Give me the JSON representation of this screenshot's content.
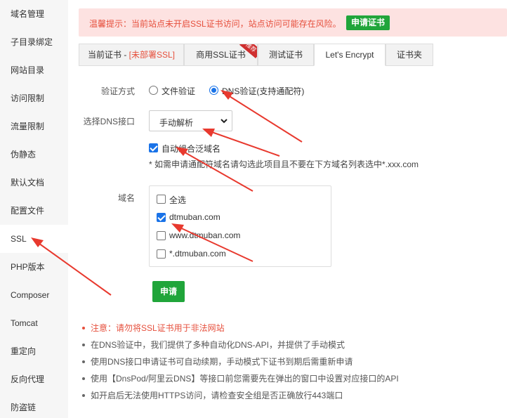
{
  "sidebar": {
    "items": [
      {
        "label": "域名管理"
      },
      {
        "label": "子目录绑定"
      },
      {
        "label": "网站目录"
      },
      {
        "label": "访问限制"
      },
      {
        "label": "流量限制"
      },
      {
        "label": "伪静态"
      },
      {
        "label": "默认文档"
      },
      {
        "label": "配置文件"
      },
      {
        "label": "SSL"
      },
      {
        "label": "PHP版本"
      },
      {
        "label": "Composer"
      },
      {
        "label": "Tomcat"
      },
      {
        "label": "重定向"
      },
      {
        "label": "反向代理"
      },
      {
        "label": "防盗链"
      }
    ],
    "active": "SSL"
  },
  "alert": {
    "text": "温馨提示：当前站点未开启SSL证书访问，站点访问可能存在风险。",
    "button": "申请证书"
  },
  "tabs": {
    "current_prefix": "当前证书 - ",
    "current_status": "[未部署SSL]",
    "commercial": "商用SSL证书",
    "ribbon": "推荐",
    "test": "测试证书",
    "letsencrypt": "Let's Encrypt",
    "folder": "证书夹",
    "active": "Let's Encrypt"
  },
  "form": {
    "verify_label": "验证方式",
    "verify_options": [
      "文件验证",
      "DNS验证(支持通配符)"
    ],
    "verify_selected": "DNS验证(支持通配符)",
    "dns_label": "选择DNS接口",
    "dns_value": "手动解析",
    "auto_combine_label": "自动组合泛域名",
    "auto_combine_checked": true,
    "hint": "* 如需申请通配符域名请勾选此项目且不要在下方域名列表选中*.xxx.com",
    "domain_label": "域名",
    "select_all": "全选",
    "domains": [
      {
        "name": "dtmuban.com",
        "checked": true
      },
      {
        "name": "www.dtmuban.com",
        "checked": false
      },
      {
        "name": "*.dtmuban.com",
        "checked": false
      }
    ],
    "apply_button": "申请"
  },
  "notes": [
    "注意：请勿将SSL证书用于非法网站",
    "在DNS验证中，我们提供了多种自动化DNS-API，并提供了手动模式",
    "使用DNS接口申请证书可自动续期，手动模式下证书到期后需重新申请",
    "使用【DnsPod/阿里云DNS】等接口前您需要先在弹出的窗口中设置对应接口的API",
    "如开启后无法使用HTTPS访问，请检查安全组是否正确放行443端口"
  ],
  "colors": {
    "accent_green": "#20a53a",
    "warning_red": "#e64f3c",
    "alert_bg": "#fde2e1",
    "radio_blue": "#1a73e8",
    "arrow_red": "#e8392e"
  }
}
